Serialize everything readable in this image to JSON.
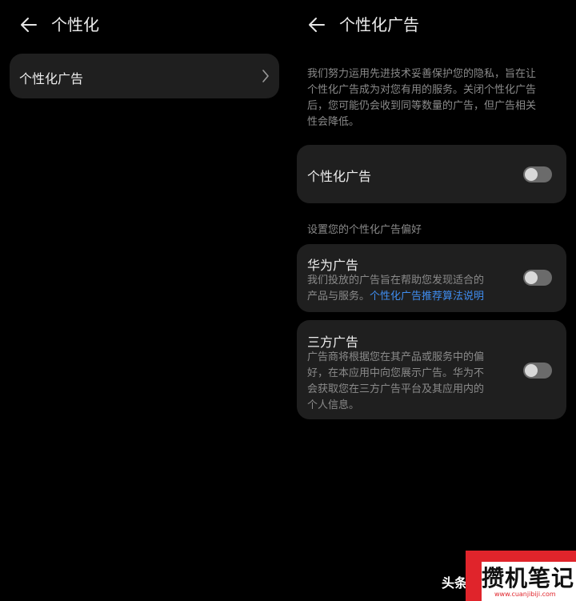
{
  "left": {
    "header": {
      "title": "个性化"
    },
    "menu": {
      "item_label": "个性化广告"
    }
  },
  "right": {
    "header": {
      "title": "个性化广告"
    },
    "intro": [
      "我们努力运用先进技术妥善保护您的隐私，旨在让",
      "个性化广告成为对您有用的服务。关闭个性化广告",
      "后，您可能仍会收到同等数量的广告，但广告相关",
      "性会降低。"
    ],
    "main_toggle": {
      "label": "个性化广告",
      "on": false
    },
    "section_title": "设置您的个性化广告偏好",
    "huawei": {
      "title": "华为广告",
      "desc_line1": "我们投放的广告旨在帮助您发现适合的",
      "desc_line2_prefix": "产品与服务。",
      "desc_link": "个性化广告推荐算法说明",
      "on": false
    },
    "third_party": {
      "title": "三方广告",
      "desc": [
        "广告商将根据您在其产品或服务中的偏",
        "好，在本应用中向您展示广告。华为不",
        "会获取您在三方广告平台及其应用内的",
        "个人信息。"
      ],
      "on": false
    }
  },
  "watermark": {
    "prefix": "头条",
    "brand": "攒机笔记",
    "url": "www.cuanjibiji.com"
  },
  "colors": {
    "background": "#000000",
    "card": "#1f1f1f",
    "link": "#3f8df0",
    "toggle_off_track": "#6b6b6b",
    "watermark_red": "#e0242b"
  }
}
